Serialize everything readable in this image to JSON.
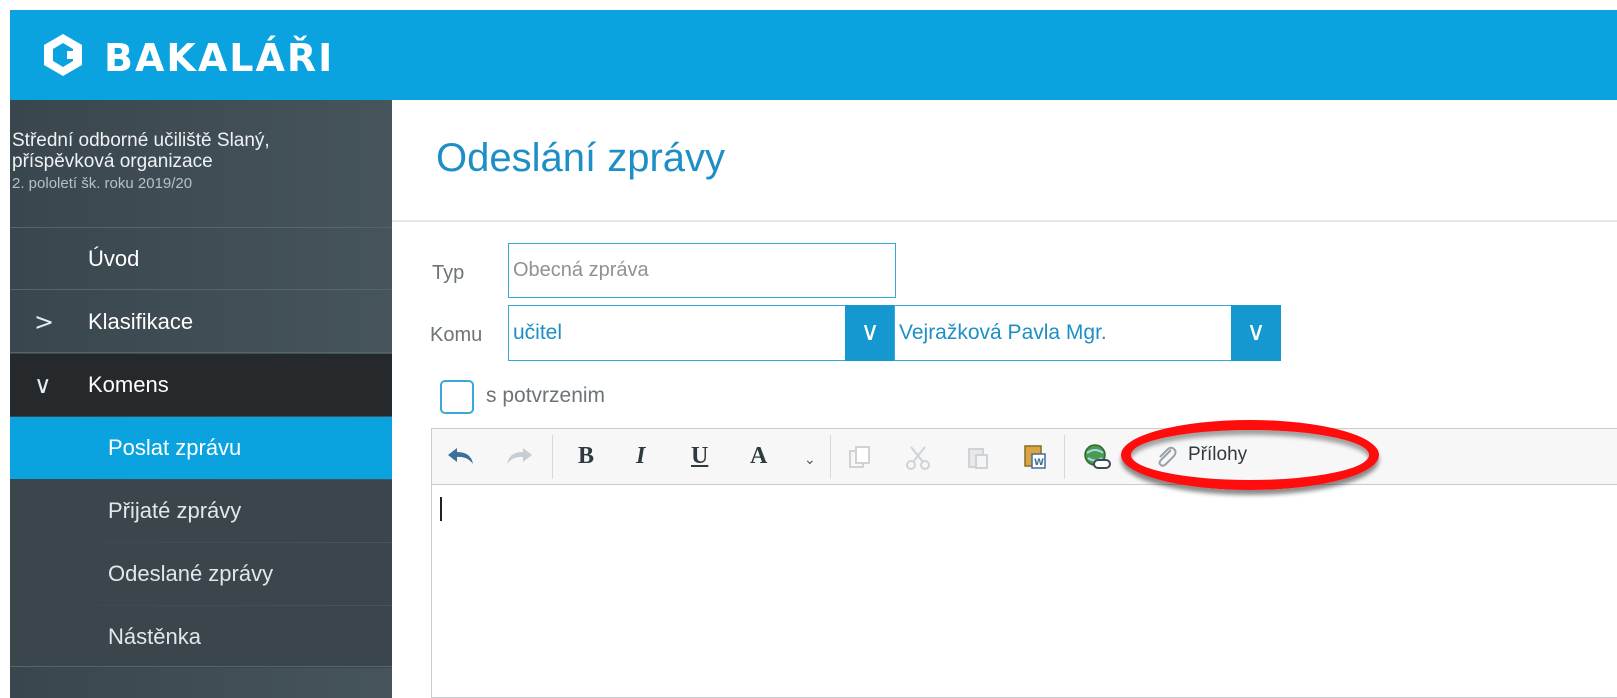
{
  "app": {
    "brand": "BAKALÁŘI"
  },
  "school": {
    "name_line1": "Střední odborné učiliště Slaný,",
    "name_line2": "příspěvková organizace",
    "term": "2. pololetí šk. roku 2019/20"
  },
  "nav": {
    "uvod": "Úvod",
    "klasifikace": "Klasifikace",
    "komens": "Komens",
    "poslat": "Poslat zprávu",
    "prijate": "Přijaté zprávy",
    "odeslane": "Odeslané zprávy",
    "nastenka": "Nástěnka",
    "chev_collapsed": ">",
    "chev_expanded": "∨"
  },
  "page": {
    "title": "Odeslání zprávy"
  },
  "form": {
    "typ_label": "Typ",
    "typ_value": "Obecná zpráva",
    "komu_label": "Komu",
    "recipient_group": "učitel",
    "recipient_name": "Vejražková Pavla Mgr.",
    "confirm_label": "s potvrzenim"
  },
  "toolbar": {
    "bold": "B",
    "italic": "I",
    "underline": "U",
    "font_color": "A",
    "attachments": "Přílohy"
  },
  "colors": {
    "brand_blue": "#0aa3df",
    "sidebar_dark": "#3a464d",
    "active_blue": "#0aa3df",
    "highlight_red": "#ff0d0d",
    "link_blue": "#1e8fc6"
  }
}
